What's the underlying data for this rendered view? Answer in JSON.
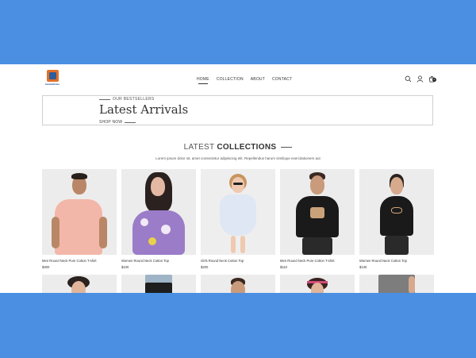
{
  "brand": {
    "name": "kaaltadikhao",
    "logo_colors": [
      "#e2702a",
      "#2f5d99"
    ]
  },
  "nav": {
    "items": [
      "HOME",
      "COLLECTION",
      "ABOUT",
      "CONTACT"
    ],
    "active": "HOME"
  },
  "header_icons": [
    "search-icon",
    "user-icon",
    "cart-icon"
  ],
  "cart": {
    "count": "0"
  },
  "banner": {
    "subtitle": "OUR BESTSELLERS",
    "title": "Latest Arrivals",
    "cta": "SHOP NOW"
  },
  "collections": {
    "title_light": "LATEST",
    "title_bold": "COLLECTIONS",
    "description": "Lorem ipsum dolor sit, amet consectetur adipisicing elit. Repellendus harum similique exercitationem aut"
  },
  "products": [
    {
      "name": "Men Round Neck Pure Cotton T-shirt",
      "price": "$300"
    },
    {
      "name": "Women Round Neck Cotton Top",
      "price": "$100"
    },
    {
      "name": "Girls Round Neck Cotton Top",
      "price": "$200"
    },
    {
      "name": "Men Round Neck Pure Cotton T-shirt",
      "price": "$110"
    },
    {
      "name": "Women Round Neck Cotton Top",
      "price": "$130"
    }
  ],
  "colors": {
    "background": "#4a8fe2",
    "page": "#ffffff",
    "text": "#333333"
  }
}
